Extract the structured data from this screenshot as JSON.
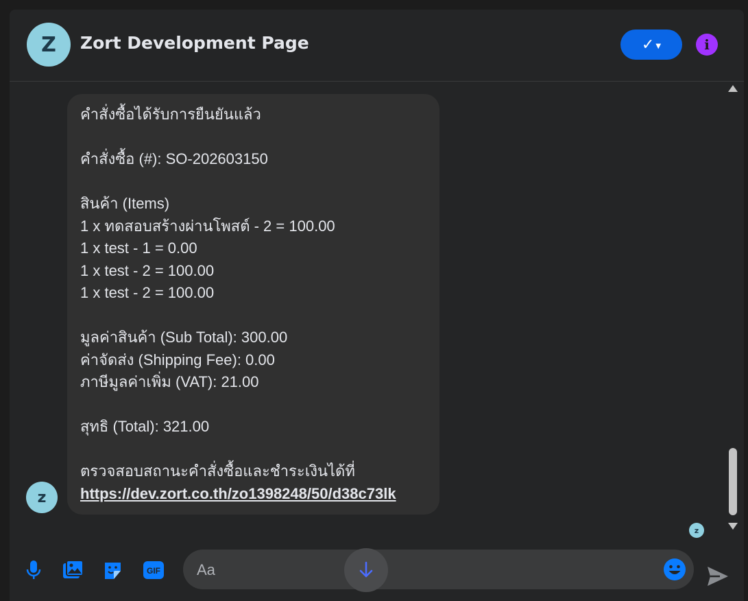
{
  "header": {
    "avatar_letter": "Z",
    "title": "Zort Development Page",
    "check_icon": "check-dropdown-icon",
    "info_icon": "info-icon"
  },
  "message": {
    "avatar_letter": "z",
    "lines": [
      "คำสั่งซื้อได้รับการยืนยันแล้ว",
      "",
      "คำสั่งซื้อ (#): SO-202603150",
      "",
      "สินค้า (Items)",
      "1 x ทดสอบสร้างผ่านโพสต์ - 2 = 100.00",
      "1 x test - 1 = 0.00",
      "1 x test - 2 = 100.00",
      "1 x test - 2 = 100.00",
      "",
      "มูลค่าสินค้า (Sub Total): 300.00",
      "ค่าจัดส่ง (Shipping Fee): 0.00",
      "ภาษีมูลค่าเพิ่ม (VAT): 21.00",
      "",
      "สุทธิ (Total): 321.00",
      "",
      "ตรวจสอบสถานะคำสั่งซื้อและชำระเงินได้ที่"
    ],
    "link": "https://dev.zort.co.th/zo1398248/50/d38c73lk"
  },
  "seen_avatar_letter": "z",
  "composer": {
    "placeholder": "Aa",
    "tools": [
      "microphone-icon",
      "image-icon",
      "sticker-icon",
      "gif-icon"
    ],
    "gif_label": "GIF"
  },
  "colors": {
    "accent": "#0a66e6",
    "info": "#a033ff",
    "avatar_bg": "#8fd0e0",
    "bubble_bg": "#303030",
    "window_bg": "#242526"
  }
}
